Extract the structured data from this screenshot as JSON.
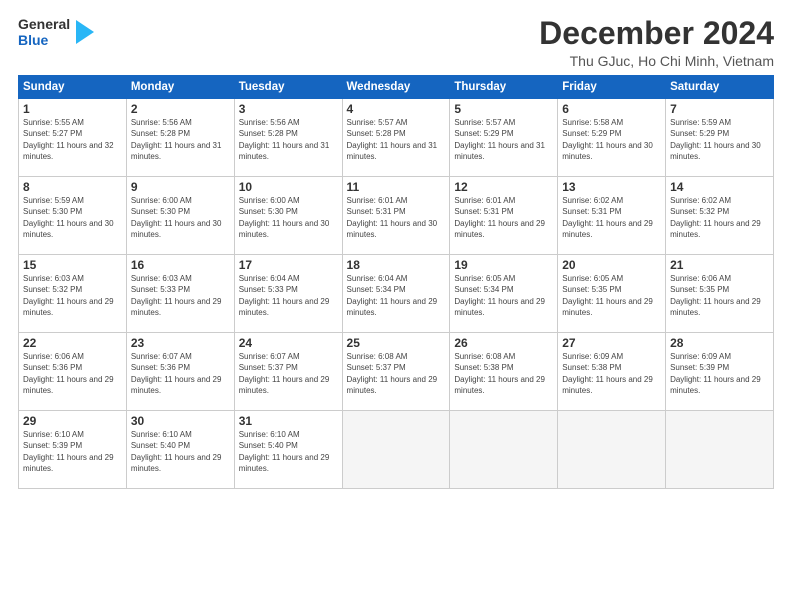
{
  "header": {
    "logo_line1": "General",
    "logo_line2": "Blue",
    "main_title": "December 2024",
    "subtitle": "Thu GJuc, Ho Chi Minh, Vietnam"
  },
  "calendar": {
    "days_of_week": [
      "Sunday",
      "Monday",
      "Tuesday",
      "Wednesday",
      "Thursday",
      "Friday",
      "Saturday"
    ],
    "weeks": [
      [
        {
          "day": "1",
          "sunrise": "Sunrise: 5:55 AM",
          "sunset": "Sunset: 5:27 PM",
          "daylight": "Daylight: 11 hours and 32 minutes."
        },
        {
          "day": "2",
          "sunrise": "Sunrise: 5:56 AM",
          "sunset": "Sunset: 5:28 PM",
          "daylight": "Daylight: 11 hours and 31 minutes."
        },
        {
          "day": "3",
          "sunrise": "Sunrise: 5:56 AM",
          "sunset": "Sunset: 5:28 PM",
          "daylight": "Daylight: 11 hours and 31 minutes."
        },
        {
          "day": "4",
          "sunrise": "Sunrise: 5:57 AM",
          "sunset": "Sunset: 5:28 PM",
          "daylight": "Daylight: 11 hours and 31 minutes."
        },
        {
          "day": "5",
          "sunrise": "Sunrise: 5:57 AM",
          "sunset": "Sunset: 5:29 PM",
          "daylight": "Daylight: 11 hours and 31 minutes."
        },
        {
          "day": "6",
          "sunrise": "Sunrise: 5:58 AM",
          "sunset": "Sunset: 5:29 PM",
          "daylight": "Daylight: 11 hours and 30 minutes."
        },
        {
          "day": "7",
          "sunrise": "Sunrise: 5:59 AM",
          "sunset": "Sunset: 5:29 PM",
          "daylight": "Daylight: 11 hours and 30 minutes."
        }
      ],
      [
        {
          "day": "8",
          "sunrise": "Sunrise: 5:59 AM",
          "sunset": "Sunset: 5:30 PM",
          "daylight": "Daylight: 11 hours and 30 minutes."
        },
        {
          "day": "9",
          "sunrise": "Sunrise: 6:00 AM",
          "sunset": "Sunset: 5:30 PM",
          "daylight": "Daylight: 11 hours and 30 minutes."
        },
        {
          "day": "10",
          "sunrise": "Sunrise: 6:00 AM",
          "sunset": "Sunset: 5:30 PM",
          "daylight": "Daylight: 11 hours and 30 minutes."
        },
        {
          "day": "11",
          "sunrise": "Sunrise: 6:01 AM",
          "sunset": "Sunset: 5:31 PM",
          "daylight": "Daylight: 11 hours and 30 minutes."
        },
        {
          "day": "12",
          "sunrise": "Sunrise: 6:01 AM",
          "sunset": "Sunset: 5:31 PM",
          "daylight": "Daylight: 11 hours and 29 minutes."
        },
        {
          "day": "13",
          "sunrise": "Sunrise: 6:02 AM",
          "sunset": "Sunset: 5:31 PM",
          "daylight": "Daylight: 11 hours and 29 minutes."
        },
        {
          "day": "14",
          "sunrise": "Sunrise: 6:02 AM",
          "sunset": "Sunset: 5:32 PM",
          "daylight": "Daylight: 11 hours and 29 minutes."
        }
      ],
      [
        {
          "day": "15",
          "sunrise": "Sunrise: 6:03 AM",
          "sunset": "Sunset: 5:32 PM",
          "daylight": "Daylight: 11 hours and 29 minutes."
        },
        {
          "day": "16",
          "sunrise": "Sunrise: 6:03 AM",
          "sunset": "Sunset: 5:33 PM",
          "daylight": "Daylight: 11 hours and 29 minutes."
        },
        {
          "day": "17",
          "sunrise": "Sunrise: 6:04 AM",
          "sunset": "Sunset: 5:33 PM",
          "daylight": "Daylight: 11 hours and 29 minutes."
        },
        {
          "day": "18",
          "sunrise": "Sunrise: 6:04 AM",
          "sunset": "Sunset: 5:34 PM",
          "daylight": "Daylight: 11 hours and 29 minutes."
        },
        {
          "day": "19",
          "sunrise": "Sunrise: 6:05 AM",
          "sunset": "Sunset: 5:34 PM",
          "daylight": "Daylight: 11 hours and 29 minutes."
        },
        {
          "day": "20",
          "sunrise": "Sunrise: 6:05 AM",
          "sunset": "Sunset: 5:35 PM",
          "daylight": "Daylight: 11 hours and 29 minutes."
        },
        {
          "day": "21",
          "sunrise": "Sunrise: 6:06 AM",
          "sunset": "Sunset: 5:35 PM",
          "daylight": "Daylight: 11 hours and 29 minutes."
        }
      ],
      [
        {
          "day": "22",
          "sunrise": "Sunrise: 6:06 AM",
          "sunset": "Sunset: 5:36 PM",
          "daylight": "Daylight: 11 hours and 29 minutes."
        },
        {
          "day": "23",
          "sunrise": "Sunrise: 6:07 AM",
          "sunset": "Sunset: 5:36 PM",
          "daylight": "Daylight: 11 hours and 29 minutes."
        },
        {
          "day": "24",
          "sunrise": "Sunrise: 6:07 AM",
          "sunset": "Sunset: 5:37 PM",
          "daylight": "Daylight: 11 hours and 29 minutes."
        },
        {
          "day": "25",
          "sunrise": "Sunrise: 6:08 AM",
          "sunset": "Sunset: 5:37 PM",
          "daylight": "Daylight: 11 hours and 29 minutes."
        },
        {
          "day": "26",
          "sunrise": "Sunrise: 6:08 AM",
          "sunset": "Sunset: 5:38 PM",
          "daylight": "Daylight: 11 hours and 29 minutes."
        },
        {
          "day": "27",
          "sunrise": "Sunrise: 6:09 AM",
          "sunset": "Sunset: 5:38 PM",
          "daylight": "Daylight: 11 hours and 29 minutes."
        },
        {
          "day": "28",
          "sunrise": "Sunrise: 6:09 AM",
          "sunset": "Sunset: 5:39 PM",
          "daylight": "Daylight: 11 hours and 29 minutes."
        }
      ],
      [
        {
          "day": "29",
          "sunrise": "Sunrise: 6:10 AM",
          "sunset": "Sunset: 5:39 PM",
          "daylight": "Daylight: 11 hours and 29 minutes."
        },
        {
          "day": "30",
          "sunrise": "Sunrise: 6:10 AM",
          "sunset": "Sunset: 5:40 PM",
          "daylight": "Daylight: 11 hours and 29 minutes."
        },
        {
          "day": "31",
          "sunrise": "Sunrise: 6:10 AM",
          "sunset": "Sunset: 5:40 PM",
          "daylight": "Daylight: 11 hours and 29 minutes."
        },
        null,
        null,
        null,
        null
      ]
    ]
  }
}
